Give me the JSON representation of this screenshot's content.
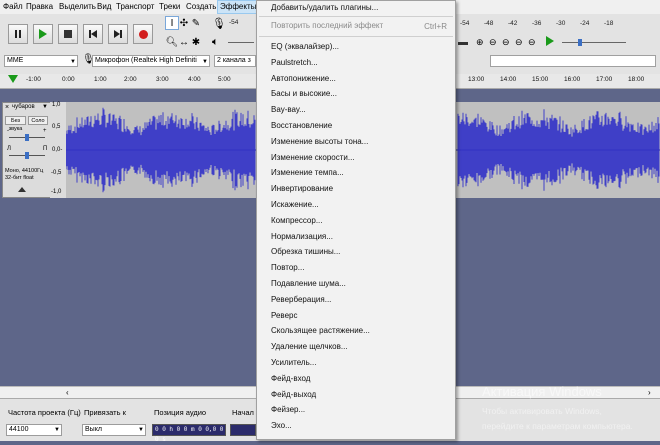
{
  "menubar": {
    "items": [
      "Файл",
      "Правка",
      "Выделить",
      "Вид",
      "Транспорт",
      "Треки",
      "Создать",
      "Эффекты"
    ]
  },
  "meters": {
    "right_ticks": [
      "-54",
      "-48",
      "-42",
      "-36",
      "-30",
      "-24",
      "-18"
    ],
    "left_tick": "-54"
  },
  "devices": {
    "host": "MME",
    "mic": "Микрофон (Realtek High Definiti",
    "channels": "2 канала з"
  },
  "ruler": {
    "left_ticks": [
      "-1:00",
      "0:00",
      "1:00",
      "2:00",
      "3:00",
      "4:00",
      "5:00"
    ],
    "right_ticks": [
      "13:00",
      "14:00",
      "15:00",
      "16:00",
      "17:00",
      "18:00"
    ]
  },
  "track": {
    "name": "чубаров",
    "mute": "Без звука",
    "solo": "Соло",
    "gain_minus": "-",
    "gain_plus": "+",
    "pan_left": "Л",
    "pan_right": "П",
    "info_line1": "Моно, 44100Гц",
    "info_line2": "32-бит float",
    "scale": [
      "1,0",
      "0,5",
      "0,0-",
      "-0,5",
      "-1,0"
    ]
  },
  "selection_bar": {
    "rate_label": "Частота проекта (Гц)",
    "rate_value": "44100",
    "snap_label": "Привязать к",
    "snap_value": "Выкл",
    "pos_label": "Позиция аудио",
    "pos_value": "0 0 h 0 0 m 0 0,0 0 0 s",
    "start_label": "Начал"
  },
  "effects_menu": {
    "top_item": "Добавить/удалить плагины...",
    "repeat_item": "Повторить последний эффект",
    "repeat_shortcut": "Ctrl+R",
    "items": [
      "EQ (эквалайзер)...",
      "Paulstretch...",
      "Автопонижение...",
      "Басы и высокие...",
      "Вау-вау...",
      "Восстановление",
      "Изменение высоты тона...",
      "Изменение скорости...",
      "Изменение темпа...",
      "Инвертирование",
      "Искажение...",
      "Компрессор...",
      "Нормализация...",
      "Обрезка тишины...",
      "Повтор...",
      "Подавление шума...",
      "Реверберация...",
      "Реверс",
      "Скользящее растяжение...",
      "Удаление щелчков...",
      "Усилитель...",
      "Фейд-вход",
      "Фейд-выход",
      "Фейзер...",
      "Эхо..."
    ]
  },
  "watermark": {
    "title": "Активация Windows",
    "line1": "Чтобы активировать Windows,",
    "line2": "перейдите к параметрам компьютера."
  },
  "colors": {
    "waveform": "#3232c8",
    "waveform_bg": "#c0c0c0",
    "workspace": "#5e6689",
    "menu_bg": "#f2f2f2"
  }
}
